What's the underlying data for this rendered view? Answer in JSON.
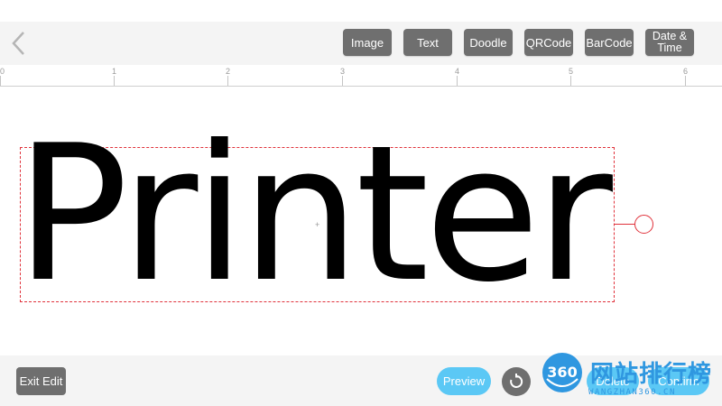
{
  "toolbar": {
    "buttons": [
      {
        "label": "Image"
      },
      {
        "label": "Text"
      },
      {
        "label": "Doodle"
      },
      {
        "label": "QRCode"
      },
      {
        "label": "BarCode"
      },
      {
        "label": "Date &\nTime"
      }
    ]
  },
  "ruler": {
    "numbers": [
      "0",
      "1",
      "2",
      "3",
      "4",
      "5",
      "6"
    ]
  },
  "canvas": {
    "text_element": "Printer",
    "center_marker": "+"
  },
  "bottom": {
    "exit_label": "Exit Edit",
    "preview_label": "Preview",
    "delete_label": "Delete",
    "confirm_label": "Confirm"
  },
  "watermark": {
    "logo_text": "360",
    "title": "网站排行榜",
    "subtitle": "WANGZHAN360.CN"
  },
  "colors": {
    "toolbar_button": "#6f6f6f",
    "accent_blue": "#5bc8f5",
    "selection_red": "#e0323b",
    "watermark_blue": "#2f97e0"
  }
}
